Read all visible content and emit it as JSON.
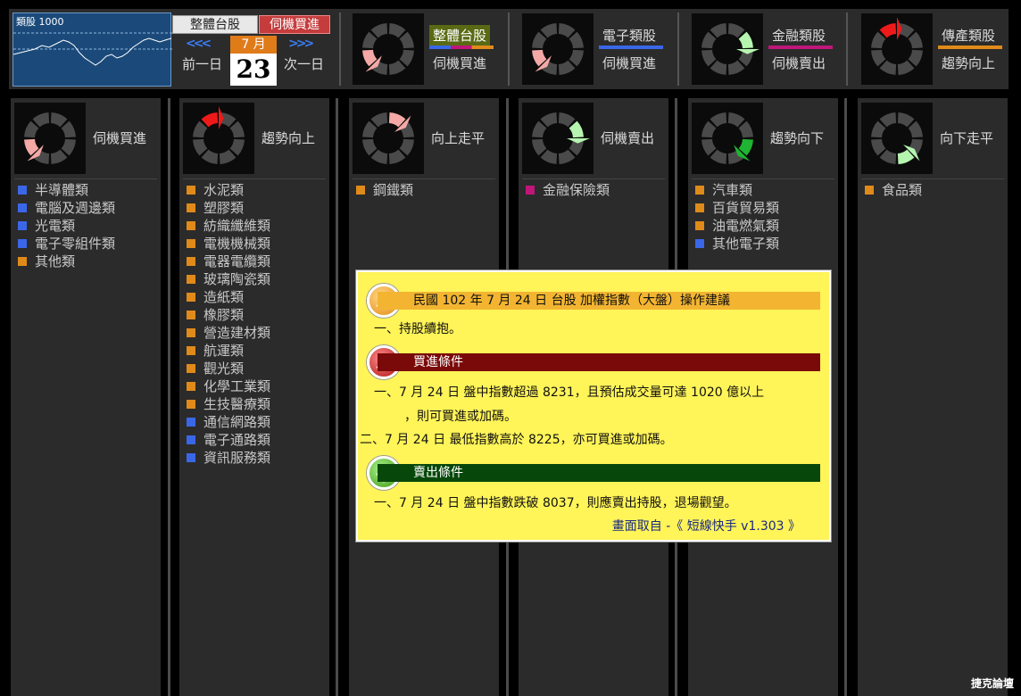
{
  "header": {
    "mini_chart_label": "類股 1000",
    "seg_overall": "整體台股",
    "seg_opportunity": "伺機買進",
    "prev_arrows": "<<<",
    "next_arrows": ">>>",
    "month": "7 月",
    "day": "23",
    "prev_day": "前一日",
    "next_day": "次一日",
    "cards": [
      {
        "t1": "整體台股",
        "t2": "伺機買進",
        "state": "buy"
      },
      {
        "t1": "電子類股",
        "t2": "伺機買進",
        "state": "buy"
      },
      {
        "t1": "金融類股",
        "t2": "伺機賣出",
        "state": "sell"
      },
      {
        "t1": "傳產類股",
        "t2": "趨勢向上",
        "state": "up"
      }
    ]
  },
  "columns": [
    {
      "title": "伺機買進",
      "state": "buy",
      "items": [
        {
          "label": "半導體類",
          "color": "#3a67e8"
        },
        {
          "label": "電腦及週邊類",
          "color": "#3a67e8"
        },
        {
          "label": "光電類",
          "color": "#3a67e8"
        },
        {
          "label": "電子零組件類",
          "color": "#3a67e8"
        },
        {
          "label": "其他類",
          "color": "#e08a1a"
        }
      ]
    },
    {
      "title": "趨勢向上",
      "state": "up",
      "items": [
        {
          "label": "水泥類",
          "color": "#e08a1a"
        },
        {
          "label": "塑膠類",
          "color": "#e08a1a"
        },
        {
          "label": "紡織纖維類",
          "color": "#e08a1a"
        },
        {
          "label": "電機機械類",
          "color": "#e08a1a"
        },
        {
          "label": "電器電纜類",
          "color": "#e08a1a"
        },
        {
          "label": "玻璃陶瓷類",
          "color": "#e08a1a"
        },
        {
          "label": "造紙類",
          "color": "#e08a1a"
        },
        {
          "label": "橡膠類",
          "color": "#e08a1a"
        },
        {
          "label": "營造建材類",
          "color": "#e08a1a"
        },
        {
          "label": "航運類",
          "color": "#e08a1a"
        },
        {
          "label": "觀光類",
          "color": "#e08a1a"
        },
        {
          "label": "化學工業類",
          "color": "#e08a1a"
        },
        {
          "label": "生技醫療類",
          "color": "#e08a1a"
        },
        {
          "label": "通信網路類",
          "color": "#3a67e8"
        },
        {
          "label": "電子通路類",
          "color": "#3a67e8"
        },
        {
          "label": "資訊服務類",
          "color": "#3a67e8"
        }
      ]
    },
    {
      "title": "向上走平",
      "state": "upflat",
      "items": [
        {
          "label": "鋼鐵類",
          "color": "#e08a1a"
        }
      ]
    },
    {
      "title": "伺機賣出",
      "state": "sell",
      "items": [
        {
          "label": "金融保險類",
          "color": "#c0167a"
        }
      ]
    },
    {
      "title": "趨勢向下",
      "state": "down",
      "items": [
        {
          "label": "汽車類",
          "color": "#e08a1a"
        },
        {
          "label": "百貨貿易類",
          "color": "#e08a1a"
        },
        {
          "label": "油電燃氣類",
          "color": "#e08a1a"
        },
        {
          "label": "其他電子類",
          "color": "#3a67e8"
        }
      ]
    },
    {
      "title": "向下走平",
      "state": "downflat",
      "items": [
        {
          "label": "食品類",
          "color": "#e08a1a"
        }
      ]
    }
  ],
  "popup": {
    "heading": "民國 102 年 7 月 24 日 台股 加權指數（大盤）操作建議",
    "advice": "一、持股續抱。",
    "buy_heading": "買進條件",
    "buy_line1": "一、7 月 24 日 盤中指數超過 8231，且預估成交量可達 1020 億以上",
    "buy_line1b": "，則可買進或加碼。",
    "buy_line2": "二、7 月 24 日 最低指數高於 8225，亦可買進或加碼。",
    "sell_heading": "賣出條件",
    "sell_line1": "一、7 月 24 日 盤中指數跌破 8037，則應賣出持股，退場觀望。",
    "footer": "畫面取自 -《 短線快手 v1.303 》"
  },
  "watermark": "捷克論壇"
}
